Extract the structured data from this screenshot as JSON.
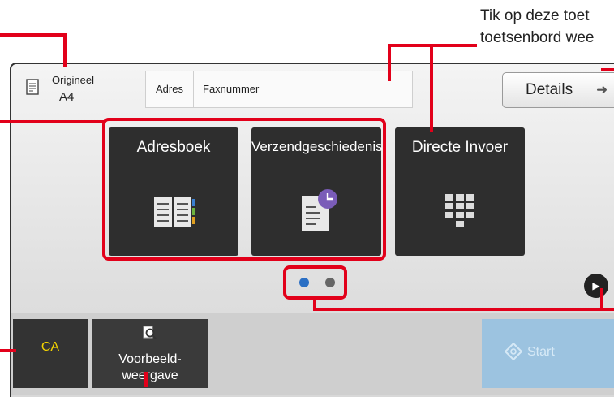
{
  "callout": {
    "line1": "Tik op deze toet",
    "line2": "toetsenbord wee"
  },
  "original": {
    "label": "Origineel",
    "size": "A4",
    "icon": "document-icon"
  },
  "address": {
    "label": "Adres",
    "field": "Faxnummer"
  },
  "details": {
    "label": "Details",
    "icon": "arrow-right-icon"
  },
  "tiles": [
    {
      "label": "Adresboek",
      "icon": "address-book-icon"
    },
    {
      "label": "Verzendgeschiedenis",
      "icon": "history-icon"
    },
    {
      "label": "Directe Invoer",
      "icon": "keypad-icon"
    }
  ],
  "pager": {
    "pages": 2,
    "current": 1
  },
  "bottom": {
    "ca_label": "CA",
    "preview_label": "Voorbeeld-\nweergave",
    "start_label": "Start"
  },
  "colors": {
    "annotation": "#e2001a",
    "tile": "#2e2e2e",
    "ca_text": "#f5d400",
    "start": "#9cc3e0",
    "dot_active": "#2b6fc4",
    "dot_inactive": "#666666"
  }
}
